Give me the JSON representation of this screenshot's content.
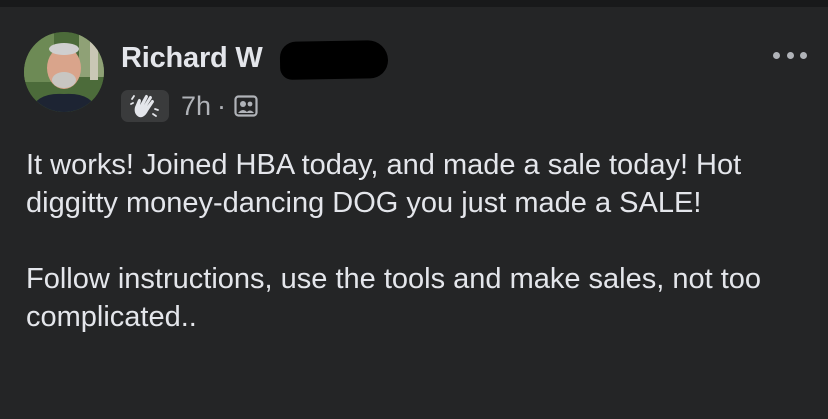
{
  "post": {
    "author_name": "Richard W",
    "time": "7h",
    "separator": "·",
    "badge_icon": "waving-hand-icon",
    "privacy_icon": "friends-photo-icon",
    "more_icon": "more-options-icon",
    "paragraphs": [
      "It works! Joined HBA today, and made a sale today! Hot diggitty money-dancing DOG you just made a SALE!",
      "Follow instructions, use the tools and make sales, not too complicated.."
    ]
  },
  "colors": {
    "background": "#242526",
    "primary_text": "#e4e6eb",
    "secondary_text": "#b0b3b8",
    "badge_background": "#3a3b3c"
  }
}
